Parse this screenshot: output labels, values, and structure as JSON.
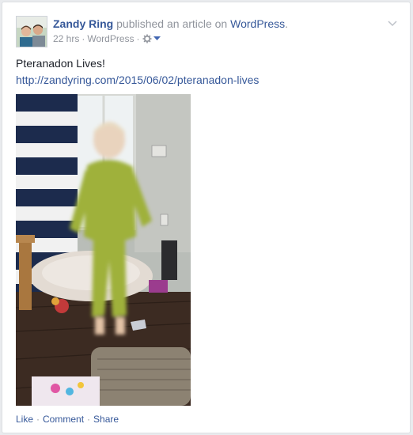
{
  "post": {
    "author": "Zandy Ring",
    "action": "published an article on",
    "site": "WordPress",
    "period": ".",
    "timestamp": "22 hrs",
    "source": "WordPress",
    "privacy_icon": "settings-gear-icon",
    "text": "Pteranadon Lives!",
    "link": "http://zandyring.com/2015/06/02/pteranadon-lives"
  },
  "actions": {
    "like": "Like",
    "comment": "Comment",
    "share": "Share"
  },
  "colors": {
    "link_blue": "#365899",
    "meta_gray": "#90949c"
  }
}
